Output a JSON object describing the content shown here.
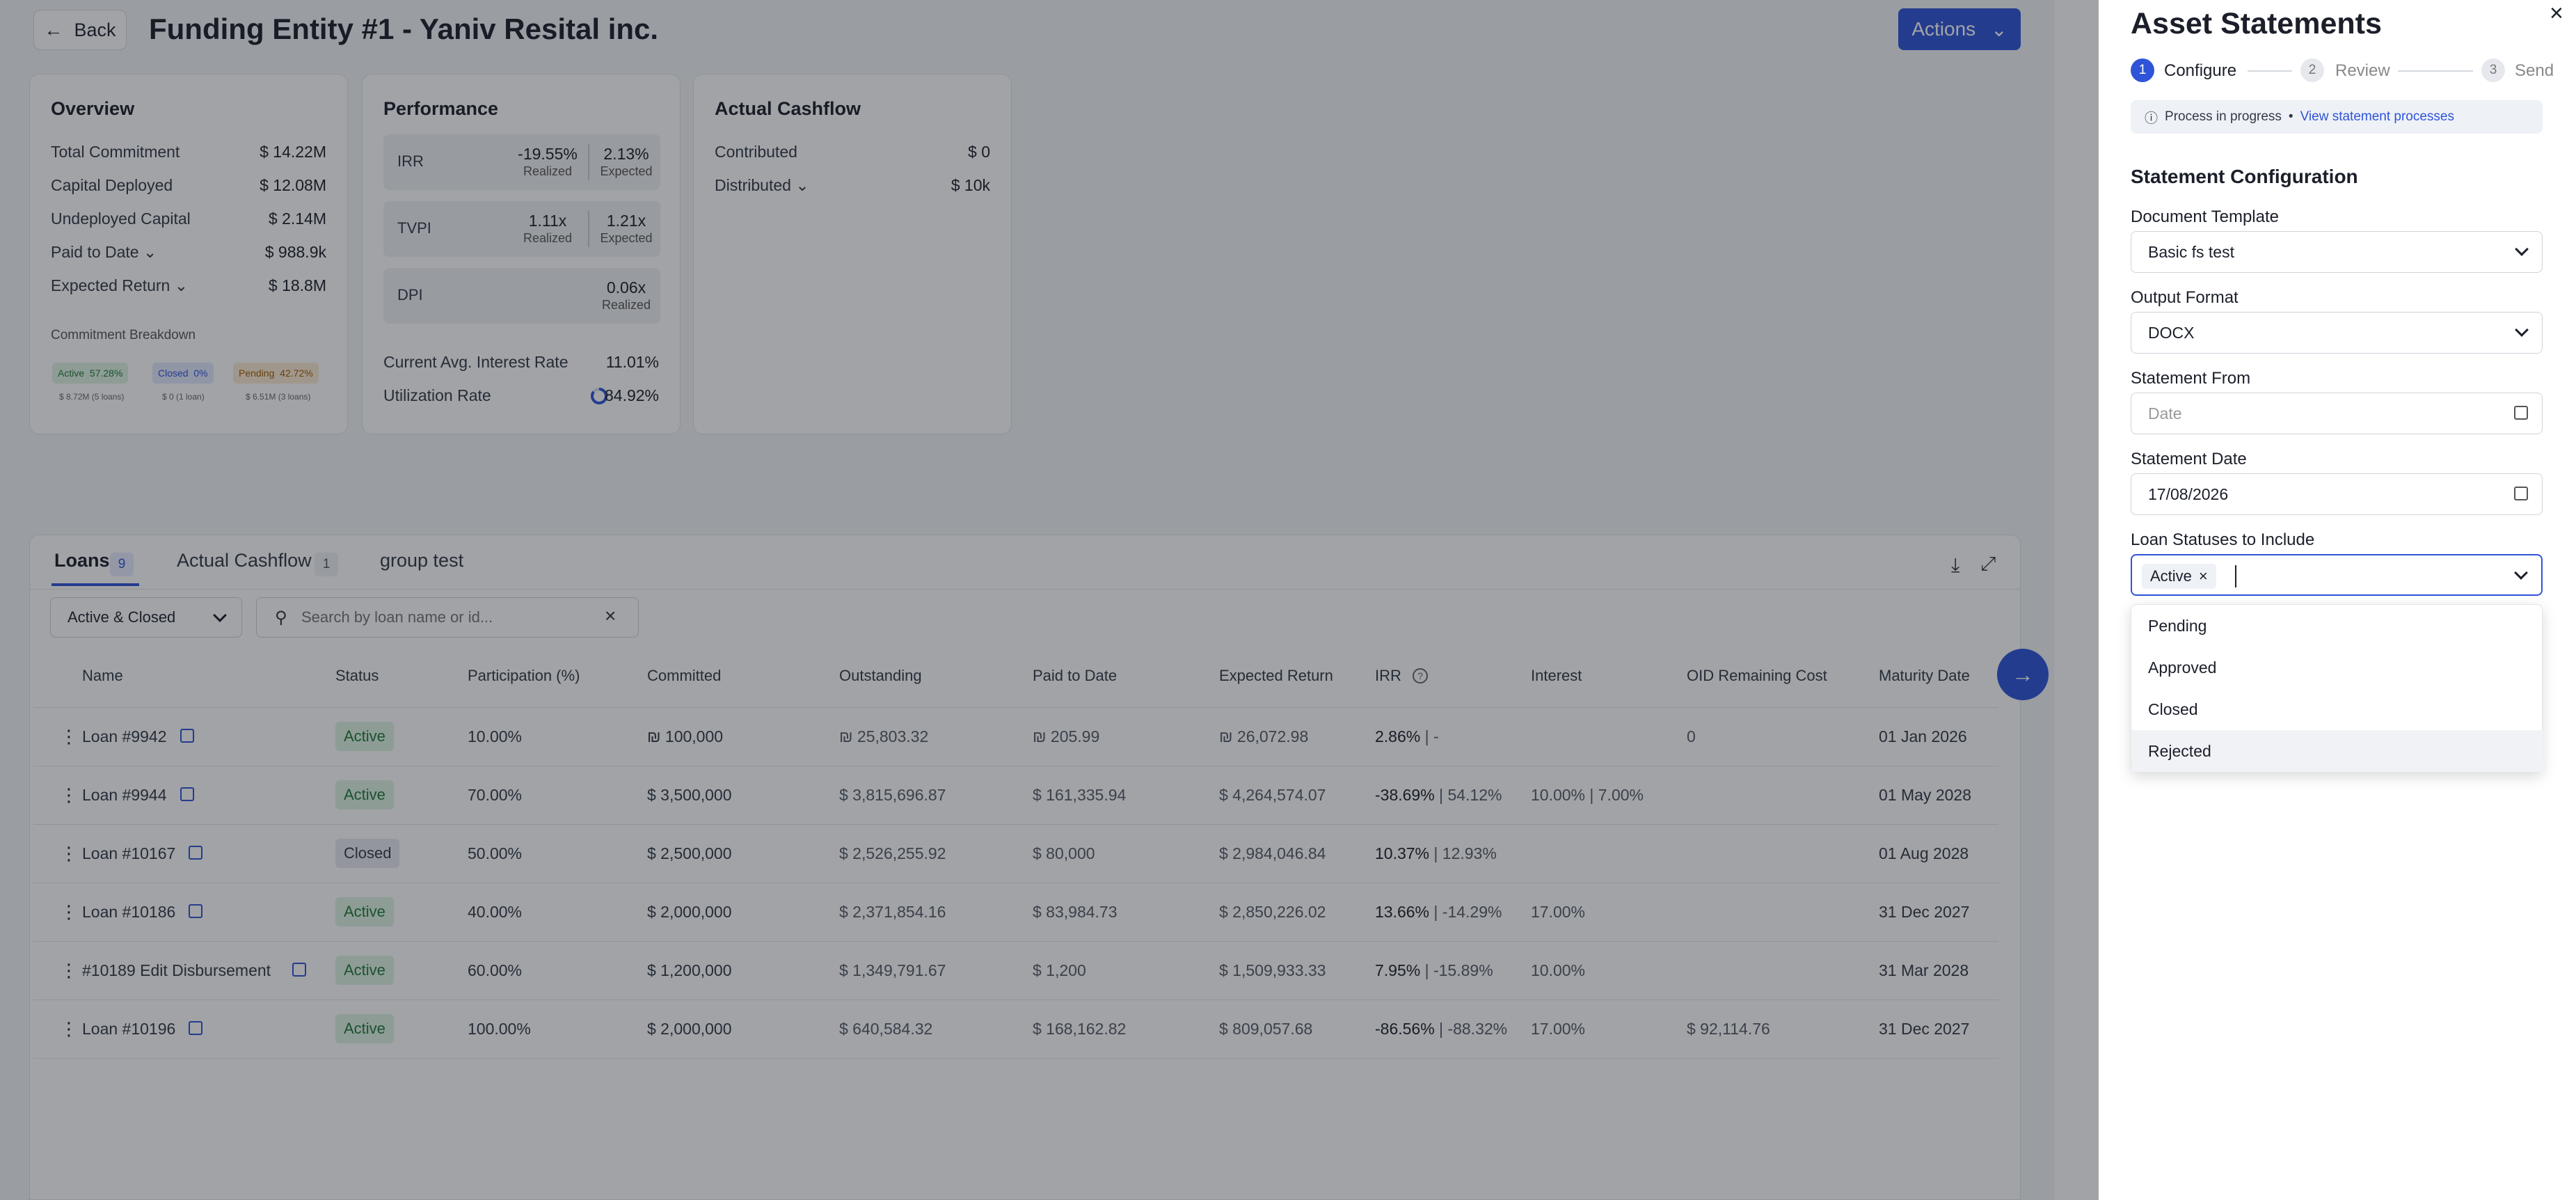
{
  "header": {
    "back_label": "Back",
    "title": "Funding Entity #1 - Yaniv Resital inc.",
    "actions_label": "Actions"
  },
  "overview": {
    "title": "Overview",
    "rows": [
      {
        "label": "Total Commitment",
        "value": "$ 14.22M"
      },
      {
        "label": "Capital Deployed",
        "value": "$ 12.08M"
      },
      {
        "label": "Undeployed Capital",
        "value": "$ 2.14M"
      },
      {
        "label": "Paid to Date",
        "value": "$ 988.9k"
      },
      {
        "label": "Expected Return",
        "value": "$ 18.8M"
      }
    ],
    "breakdown_title": "Commitment Breakdown",
    "breakdown": [
      {
        "status": "Active",
        "pct": "57.28%",
        "sub": "$ 8.72M (5 loans)"
      },
      {
        "status": "Closed",
        "pct": "0%",
        "sub": "$ 0 (1 loan)"
      },
      {
        "status": "Pending",
        "pct": "42.72%",
        "sub": "$ 6.51M (3 loans)"
      }
    ]
  },
  "performance": {
    "title": "Performance",
    "irr": {
      "label": "IRR",
      "realized": "-19.55%",
      "expected": "2.13%"
    },
    "tvpi": {
      "label": "TVPI",
      "realized": "1.11x",
      "expected": "1.21x"
    },
    "dpi": {
      "label": "DPI",
      "realized": "0.06x"
    },
    "realized_label": "Realized",
    "expected_label": "Expected",
    "interest_label": "Current Avg. Interest Rate",
    "interest_value": "11.01%",
    "util_label": "Utilization Rate",
    "util_value": "84.92%",
    "util_fraction": 0.8492
  },
  "cashflow": {
    "title": "Actual Cashflow",
    "rows": [
      {
        "label": "Contributed",
        "value": "$ 0"
      },
      {
        "label": "Distributed",
        "value": "$ 10k"
      }
    ]
  },
  "loans_section": {
    "tabs": [
      {
        "label": "Loans",
        "count": "9"
      },
      {
        "label": "Actual Cashflow",
        "count": "1"
      },
      {
        "label": "group test",
        "count": ""
      }
    ],
    "filter_value": "Active & Closed",
    "search_placeholder": "Search by loan name or id...",
    "columns": [
      "Name",
      "Status",
      "Participation (%)",
      "Committed",
      "Outstanding",
      "Paid to Date",
      "Expected Return",
      "IRR",
      "Interest",
      "OID Remaining Cost",
      "Maturity Date"
    ],
    "rows": [
      {
        "name": "Loan #9942",
        "status": "Active",
        "part": "10.00%",
        "committed": "₪ 100,000",
        "outstanding": "₪ 25,803.32",
        "paid": "₪ 205.99",
        "expected": "₪ 26,072.98",
        "irr_a": "2.86%",
        "irr_b": "-",
        "interest": "",
        "oid": "0",
        "maturity": "01 Jan 2026"
      },
      {
        "name": "Loan #9944",
        "status": "Active",
        "part": "70.00%",
        "committed": "$ 3,500,000",
        "outstanding": "$ 3,815,696.87",
        "paid": "$ 161,335.94",
        "expected": "$ 4,264,574.07",
        "irr_a": "-38.69%",
        "irr_b": "54.12%",
        "interest": "10.00% | 7.00%",
        "oid": "",
        "maturity": "01 May 2028"
      },
      {
        "name": "Loan #10167",
        "status": "Closed",
        "part": "50.00%",
        "committed": "$ 2,500,000",
        "outstanding": "$ 2,526,255.92",
        "paid": "$ 80,000",
        "expected": "$ 2,984,046.84",
        "irr_a": "10.37%",
        "irr_b": "12.93%",
        "interest": "",
        "oid": "",
        "maturity": "01 Aug 2028"
      },
      {
        "name": "Loan #10186",
        "status": "Active",
        "part": "40.00%",
        "committed": "$ 2,000,000",
        "outstanding": "$ 2,371,854.16",
        "paid": "$ 83,984.73",
        "expected": "$ 2,850,226.02",
        "irr_a": "13.66%",
        "irr_b": "-14.29%",
        "interest": "17.00%",
        "oid": "",
        "maturity": "31 Dec 2027"
      },
      {
        "name": "#10189 Edit Disbursement",
        "status": "Active",
        "part": "60.00%",
        "committed": "$ 1,200,000",
        "outstanding": "$ 1,349,791.67",
        "paid": "$ 1,200",
        "expected": "$ 1,509,933.33",
        "irr_a": "7.95%",
        "irr_b": "-15.89%",
        "interest": "10.00%",
        "oid": "",
        "maturity": "31 Mar 2028"
      },
      {
        "name": "Loan #10196",
        "status": "Active",
        "part": "100.00%",
        "committed": "$ 2,000,000",
        "outstanding": "$ 640,584.32",
        "paid": "$ 168,162.82",
        "expected": "$ 809,057.68",
        "irr_a": "-86.56%",
        "irr_b": "-88.32%",
        "interest": "17.00%",
        "oid": "$ 92,114.76",
        "maturity": "31 Dec 2027"
      }
    ]
  },
  "panel": {
    "title": "Asset Statements",
    "steps": [
      {
        "num": "1",
        "label": "Configure"
      },
      {
        "num": "2",
        "label": "Review"
      },
      {
        "num": "3",
        "label": "Send"
      }
    ],
    "info_text": "Process in progress",
    "info_sep": "•",
    "info_link": "View statement processes",
    "section_title": "Statement Configuration",
    "doc_template_label": "Document Template",
    "doc_template_value": "Basic fs test",
    "output_label": "Output Format",
    "output_value": "DOCX",
    "from_label": "Statement From",
    "from_placeholder": "Date",
    "date_label": "Statement Date",
    "date_value": "17/08/2026",
    "statuses_label": "Loan Statuses to Include",
    "selected_chip": "Active",
    "options": [
      "Pending",
      "Approved",
      "Closed",
      "Rejected"
    ]
  },
  "colors": {
    "accent": "#2f54d8",
    "active_bg": "#dff3e4",
    "active_fg": "#1e7a38"
  }
}
